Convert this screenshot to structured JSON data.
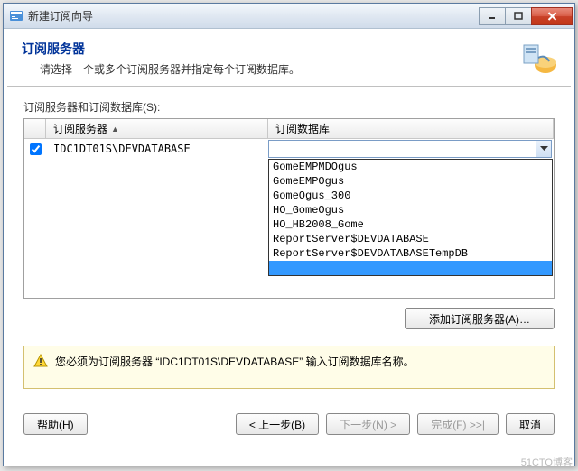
{
  "titlebar": {
    "title": "新建订阅向导"
  },
  "header": {
    "title": "订阅服务器",
    "subtitle": "请选择一个或多个订阅服务器并指定每个订阅数据库。"
  },
  "grid": {
    "label": "订阅服务器和订阅数据库(S):",
    "col1": "订阅服务器",
    "col2": "订阅数据库",
    "row_server": "IDC1DT01S\\DEVDATABASE"
  },
  "dropdown": {
    "items": [
      "GomeEMPMDOgus",
      "GomeEMPOgus",
      "GomeOgus_300",
      "HO_GomeOgus",
      "HO_HB2008_Gome",
      "ReportServer$DEVDATABASE",
      "ReportServer$DEVDATABASETempDB"
    ],
    "selected": " "
  },
  "buttons": {
    "add_server": "添加订阅服务器(A)…",
    "help": "帮助(H)",
    "back": "< 上一步(B)",
    "next": "下一步(N) >",
    "finish": "完成(F) >>|",
    "cancel": "取消"
  },
  "warning": {
    "text": "您必须为订阅服务器 “IDC1DT01S\\DEVDATABASE” 输入订阅数据库名称。"
  },
  "watermark": "51CTO博客"
}
